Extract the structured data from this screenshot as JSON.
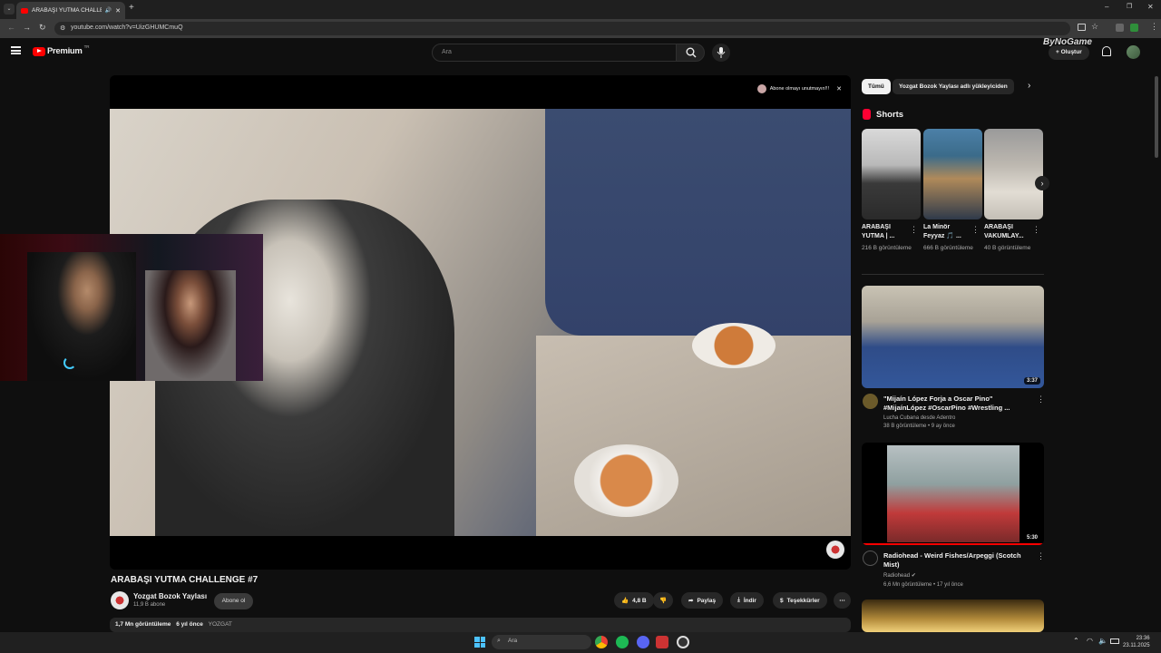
{
  "browser": {
    "tab_title": "ARABAŞI YUTMA CHALLEN...",
    "url": "youtube.com/watch?v=UizGHUMCmuQ"
  },
  "youtube": {
    "logo_text": "Premium",
    "logo_badge": "TR",
    "search_placeholder": "Ara",
    "create_label": "Oluştur",
    "watermark": "ByNoGame"
  },
  "player": {
    "overlay_text": "Abone olmayı unutmayın!!!"
  },
  "video": {
    "title": "ARABAŞI YUTMA CHALLENGE #7",
    "channel": "Yozgat Bozok Yaylası",
    "subscribers": "11,9 B abone",
    "subscribe_label": "Abone ol",
    "likes": "4,8 B",
    "share_label": "Paylaş",
    "download_label": "İndir",
    "thanks_label": "Teşekkürler",
    "views": "1,7 Mn görüntüleme",
    "age": "6 yıl önce",
    "tag": "YOZGAT"
  },
  "sidebar": {
    "chips": [
      "Tümü",
      "Yozgat Bozok Yaylası adlı yükleyiciden"
    ],
    "shorts_heading": "Shorts",
    "shorts": [
      {
        "title": "ARABAŞI YUTMA | ...",
        "views": "216 B görüntüleme"
      },
      {
        "title": "La Minör Feyyaz 🎵 ...",
        "views": "666 B görüntüleme"
      },
      {
        "title": "ARABAŞI VAKUMLAY...",
        "views": "40 B görüntüleme"
      }
    ],
    "videos": [
      {
        "title": "\"Mijaín López Forja a Oscar Pino\" #MijaínLópez #OscarPino #Wrestling ...",
        "channel": "Lucha Cubana desde Adentro",
        "meta": "38 B görüntüleme • 9 ay önce",
        "duration": "3:37"
      },
      {
        "title": "Radiohead - Weird Fishes/Arpeggi (Scotch Mist)",
        "channel": "Radiohead",
        "meta": "6,6 Mn görüntüleme • 17 yıl önce",
        "duration": "5:30"
      }
    ]
  },
  "taskbar": {
    "search_label": "Ara",
    "time": "23:36",
    "date": "23.11.2025"
  }
}
